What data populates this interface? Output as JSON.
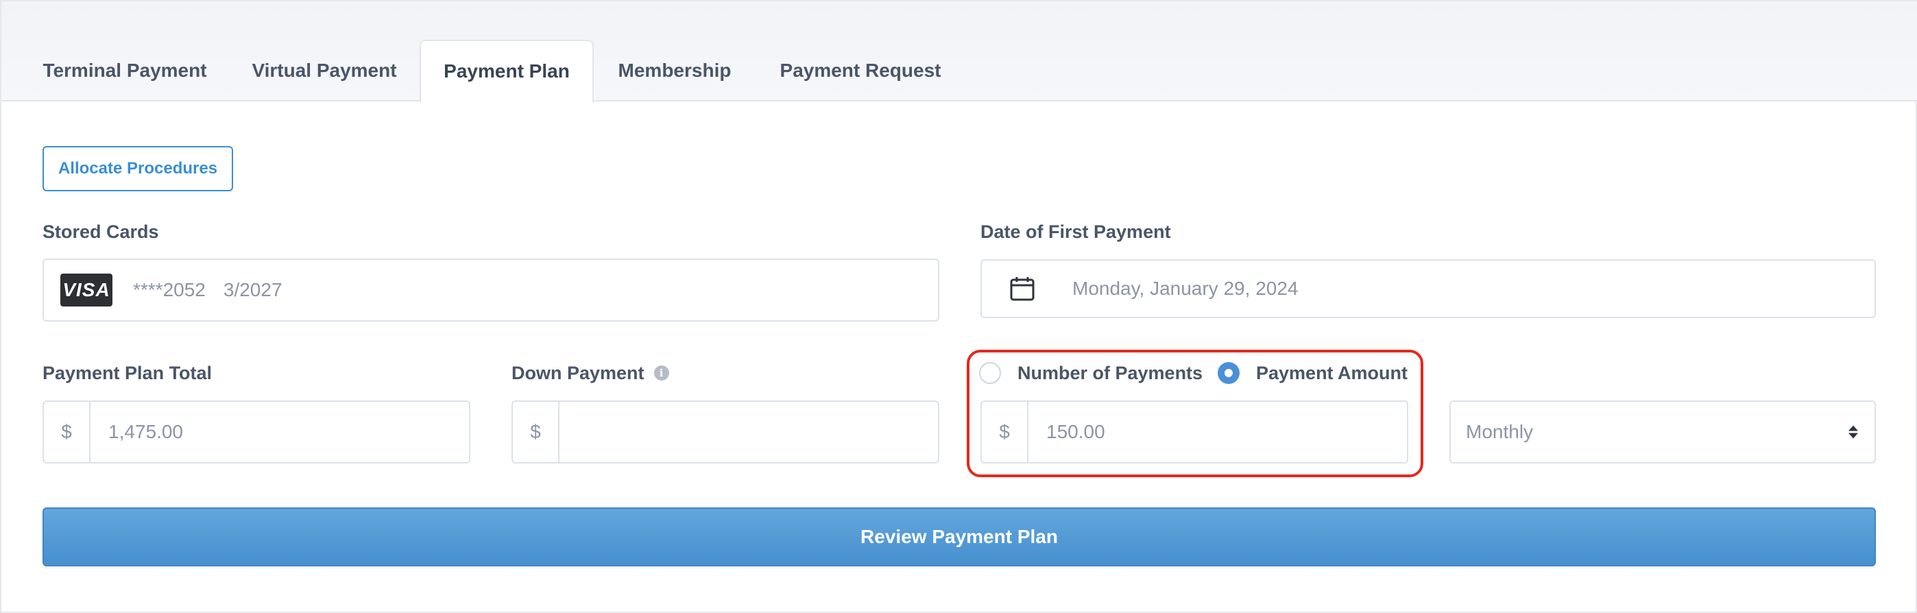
{
  "tabs": [
    {
      "label": "Terminal Payment",
      "active": false
    },
    {
      "label": "Virtual Payment",
      "active": false
    },
    {
      "label": "Payment Plan",
      "active": true
    },
    {
      "label": "Membership",
      "active": false
    },
    {
      "label": "Payment Request",
      "active": false
    }
  ],
  "allocate_button": "Allocate Procedures",
  "stored_cards": {
    "label": "Stored Cards",
    "brand": "VISA",
    "number": "****2052",
    "expiry": "3/2027"
  },
  "first_payment": {
    "label": "Date of First Payment",
    "icon": "calendar-icon",
    "value": "Monday, January 29, 2024"
  },
  "plan_total": {
    "label": "Payment Plan Total",
    "currency": "$",
    "value": "1,475.00"
  },
  "down_payment": {
    "label": "Down Payment",
    "info_icon": "i",
    "currency": "$",
    "value": ""
  },
  "payment_mode": {
    "option_count": "Number of Payments",
    "option_amount": "Payment Amount",
    "selected": "Payment Amount",
    "currency": "$",
    "value": "150.00"
  },
  "frequency": {
    "selected": "Monthly"
  },
  "review_button": "Review Payment Plan",
  "colors": {
    "accent": "#3a8fd0",
    "highlight": "#e22a1d"
  }
}
